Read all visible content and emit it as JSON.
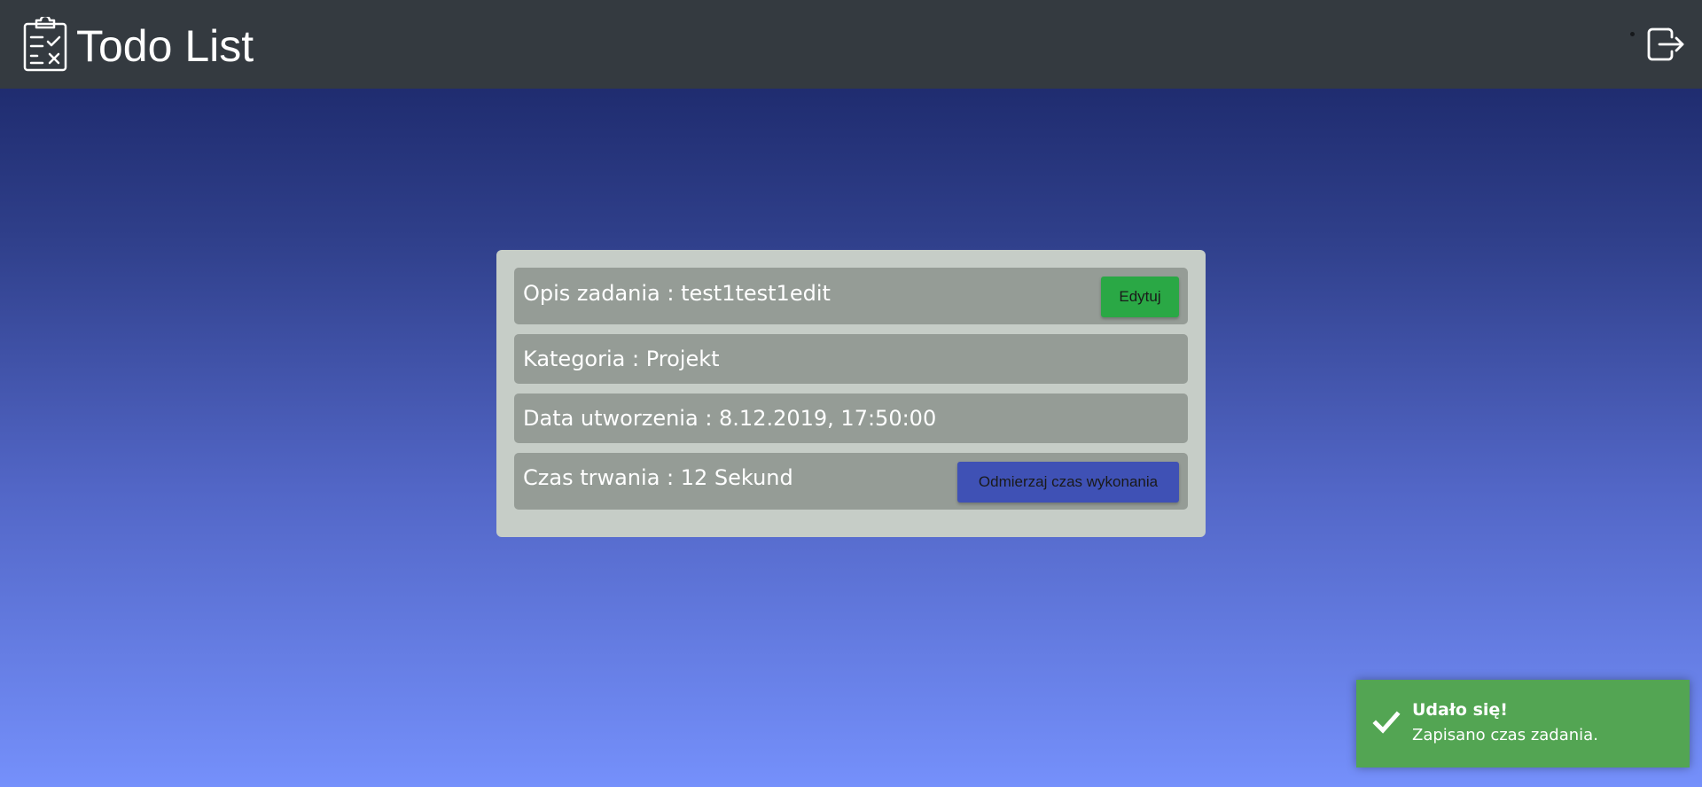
{
  "navbar": {
    "title": "Todo List",
    "brand_icon": "clipboard-checklist-icon",
    "logout_icon": "logout-icon",
    "background_color": "#343a40"
  },
  "task": {
    "description_label": "Opis zadania : test1test1edit",
    "category_label": "Kategoria : Projekt",
    "created_label": "Data utworzenia : 8.12.2019, 17:50:00",
    "duration_label": "Czas trwania : 12 Sekund",
    "edit_button_label": "Edytuj",
    "timer_button_label": "Odmierzaj czas wykonania"
  },
  "toast": {
    "title": "Udało się!",
    "message": "Zapisano czas zadania.",
    "icon": "checkmark-icon",
    "color": "#53a553"
  },
  "colors": {
    "card": "#c6cdc7",
    "row": "#959c96",
    "edit_button": "#2aa845",
    "timer_button": "#3f51b5",
    "background_top": "#162160",
    "background_bottom": "#7590fb"
  }
}
